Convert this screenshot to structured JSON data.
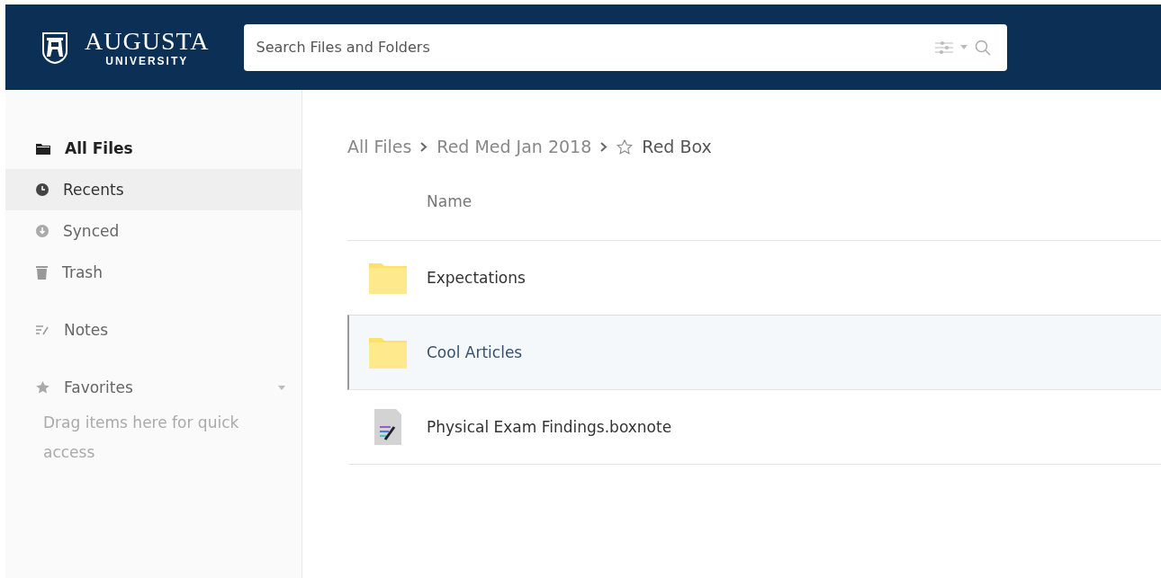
{
  "header": {
    "logo": {
      "name": "AUGUSTA",
      "subtitle": "UNIVERSITY"
    },
    "search": {
      "placeholder": "Search Files and Folders"
    }
  },
  "sidebar": {
    "items": [
      {
        "label": "All Files",
        "kind": "folder",
        "selected": true,
        "hovered": false
      },
      {
        "label": "Recents",
        "kind": "clock",
        "selected": false,
        "hovered": true
      },
      {
        "label": "Synced",
        "kind": "sync",
        "selected": false,
        "hovered": false
      },
      {
        "label": "Trash",
        "kind": "trash",
        "selected": false,
        "hovered": false
      }
    ],
    "notes": {
      "label": "Notes"
    },
    "favorites": {
      "label": "Favorites",
      "expanded": true,
      "hint": "Drag items here for quick access"
    }
  },
  "breadcrumb": [
    {
      "label": "All Files",
      "current": false
    },
    {
      "label": "Red Med Jan 2018",
      "current": false
    },
    {
      "label": "Red Box",
      "current": true
    }
  ],
  "table": {
    "columns": [
      "Name"
    ],
    "rows": [
      {
        "name": "Expectations",
        "kind": "folder",
        "selected": false
      },
      {
        "name": "Cool Articles",
        "kind": "folder",
        "selected": true
      },
      {
        "name": "Physical Exam Findings.boxnote",
        "kind": "boxnote",
        "selected": false
      }
    ]
  }
}
